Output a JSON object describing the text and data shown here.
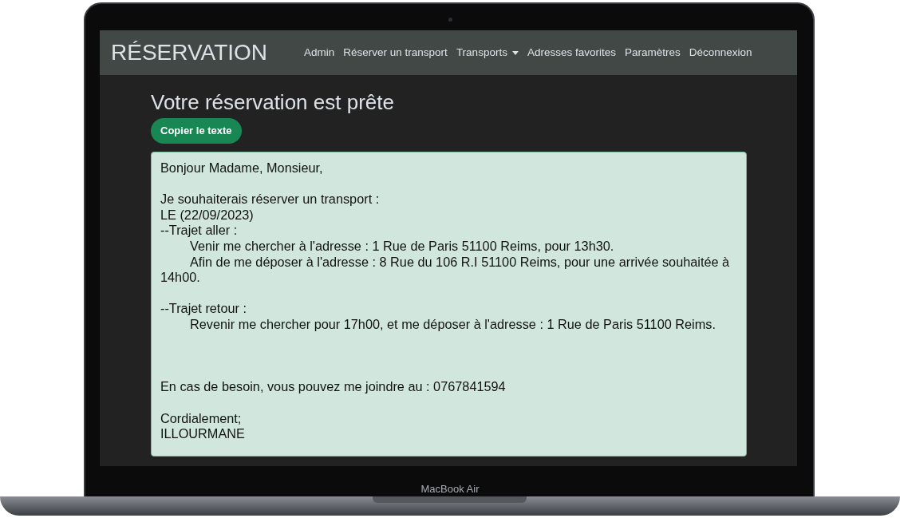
{
  "navbar": {
    "brand": "RÉSERVATION",
    "links": [
      {
        "label": "Admin",
        "kind": "link"
      },
      {
        "label": "Réserver un transport",
        "kind": "link"
      },
      {
        "label": "Transports",
        "kind": "dropdown"
      },
      {
        "label": "Adresses favorites",
        "kind": "link"
      },
      {
        "label": "Paramètres",
        "kind": "link"
      },
      {
        "label": "Déconnexion",
        "kind": "link"
      }
    ]
  },
  "title": "Votre réservation est prête",
  "copy_button": "Copier le texte",
  "message": [
    {
      "kind": "text",
      "text": "Bonjour Madame, Monsieur,"
    },
    {
      "kind": "blank"
    },
    {
      "kind": "text",
      "text": "Je souhaiterais réserver un transport :"
    },
    {
      "kind": "text",
      "text": "LE (22/09/2023)"
    },
    {
      "kind": "text",
      "text": "--Trajet aller :"
    },
    {
      "kind": "indented",
      "text": "Venir me chercher à l'adresse : 1 Rue de Paris 51100 Reims, pour 13h30."
    },
    {
      "kind": "indented",
      "text": "Afin de me déposer à l'adresse : 8 Rue du 106 R.I 51100 Reims, pour une arrivée souhaitée à 14h00."
    },
    {
      "kind": "blank"
    },
    {
      "kind": "text",
      "text": "--Trajet retour :"
    },
    {
      "kind": "indented",
      "text": "Revenir me chercher pour 17h00, et me déposer à l'adresse : 1 Rue de Paris 51100 Reims."
    },
    {
      "kind": "blank"
    },
    {
      "kind": "blank"
    },
    {
      "kind": "blank"
    },
    {
      "kind": "text",
      "text": "En cas de besoin, vous pouvez me joindre au : 0767841594"
    },
    {
      "kind": "blank"
    },
    {
      "kind": "text",
      "text": "Cordialement;"
    },
    {
      "kind": "text",
      "text": "ILLOURMANE"
    }
  ],
  "device_label": "MacBook Air"
}
